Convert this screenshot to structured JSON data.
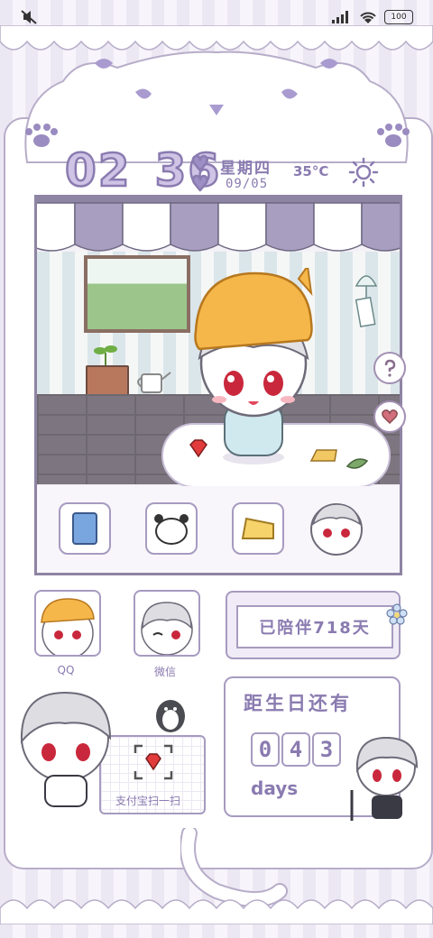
{
  "status_bar": {
    "battery": "100",
    "icons": [
      "mute-icon",
      "signal-icon",
      "wifi-icon",
      "battery-icon"
    ]
  },
  "widget": {
    "clock_hours": "02",
    "clock_minutes": "36",
    "weekday": "星期四",
    "date": "09/05",
    "temperature": "35°C",
    "weather_icon": "sun-icon"
  },
  "apps": [
    {
      "label": "QQ"
    },
    {
      "label": "微信"
    }
  ],
  "days_together": "已陪伴718天",
  "birthday": {
    "title": "距生日还有",
    "digits": [
      "0",
      "4",
      "3"
    ],
    "unit": "days"
  },
  "alipay": {
    "label": "支付宝扫一扫"
  },
  "colors": {
    "accent": "#8a7bb0",
    "border": "#a79bc0",
    "hat": "#f6b74a"
  }
}
